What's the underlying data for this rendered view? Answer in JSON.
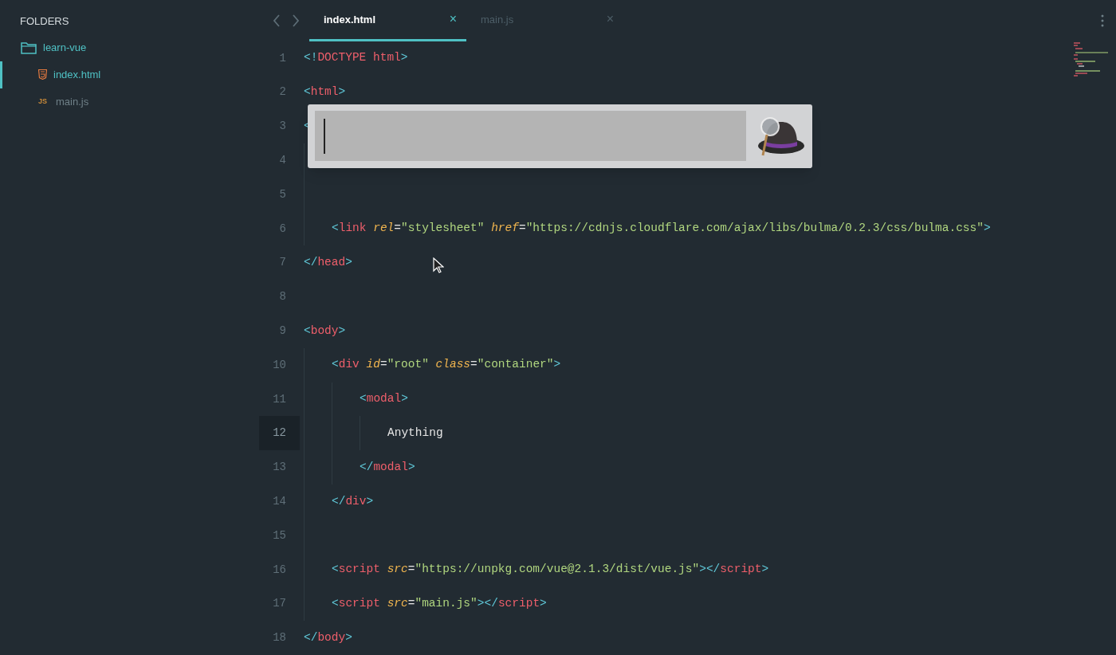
{
  "sidebar": {
    "title": "FOLDERS",
    "tree": [
      {
        "label": "learn-vue",
        "kind": "folder",
        "expanded": true,
        "selected": false,
        "children": [
          {
            "label": "index.html",
            "kind": "html",
            "selected": true
          },
          {
            "label": "main.js",
            "kind": "js",
            "badge": "JS",
            "selected": false
          }
        ]
      }
    ]
  },
  "tabs": [
    {
      "label": "index.html",
      "selected": true,
      "close": "×"
    },
    {
      "label": "main.js",
      "selected": false,
      "close": "×"
    }
  ],
  "editor": {
    "lines": [
      {
        "number": "1",
        "active": false,
        "tokens": [
          {
            "kind": "punct",
            "text": "<!"
          },
          {
            "kind": "tag",
            "text": "DOCTYPE html"
          },
          {
            "kind": "punct",
            "text": ">"
          }
        ]
      },
      {
        "number": "2",
        "active": false,
        "tokens": [
          {
            "kind": "punct",
            "text": "<"
          },
          {
            "kind": "tag",
            "text": "html"
          },
          {
            "kind": "punct",
            "text": ">"
          }
        ]
      },
      {
        "number": "3",
        "active": false,
        "tokens": [
          {
            "kind": "punct",
            "text": "<"
          }
        ],
        "children": [
          {
            "number": "4",
            "active": false
          },
          {
            "number": "5",
            "active": false
          },
          {
            "number": "6",
            "active": false,
            "tokens": [
              {
                "kind": "punct",
                "text": "<"
              },
              {
                "kind": "tag",
                "text": "link "
              },
              {
                "kind": "attr",
                "text": "rel"
              },
              {
                "kind": "plain",
                "text": "="
              },
              {
                "kind": "string",
                "text": "\"stylesheet\" "
              },
              {
                "kind": "attr",
                "text": "href"
              },
              {
                "kind": "plain",
                "text": "="
              },
              {
                "kind": "string",
                "text": "\"https://cdnjs.cloudflare.com/ajax/libs/bulma/0.2.3/css/bulma.css\""
              },
              {
                "kind": "punct",
                "text": ">"
              }
            ]
          }
        ]
      },
      {
        "number": "7",
        "active": false,
        "tokens": [
          {
            "kind": "punct",
            "text": "</"
          },
          {
            "kind": "tag",
            "text": "head"
          },
          {
            "kind": "punct",
            "text": ">"
          }
        ]
      },
      {
        "number": "8",
        "active": false
      },
      {
        "number": "9",
        "active": false,
        "tokens": [
          {
            "kind": "punct",
            "text": "<"
          },
          {
            "kind": "tag",
            "text": "body"
          },
          {
            "kind": "punct",
            "text": ">"
          }
        ],
        "children": [
          {
            "number": "10",
            "active": false,
            "tokens": [
              {
                "kind": "punct",
                "text": "<"
              },
              {
                "kind": "tag",
                "text": "div "
              },
              {
                "kind": "attr",
                "text": "id"
              },
              {
                "kind": "plain",
                "text": "="
              },
              {
                "kind": "string",
                "text": "\"root\" "
              },
              {
                "kind": "attr",
                "text": "class"
              },
              {
                "kind": "plain",
                "text": "="
              },
              {
                "kind": "string",
                "text": "\"container\""
              },
              {
                "kind": "punct",
                "text": ">"
              }
            ],
            "children": [
              {
                "number": "11",
                "active": false,
                "tokens": [
                  {
                    "kind": "punct",
                    "text": "<"
                  },
                  {
                    "kind": "tag",
                    "text": "modal"
                  },
                  {
                    "kind": "punct",
                    "text": ">"
                  }
                ],
                "children": [
                  {
                    "number": "12",
                    "active": true,
                    "tokens": [
                      {
                        "kind": "plain",
                        "text": "Anything"
                      }
                    ]
                  }
                ]
              },
              {
                "number": "13",
                "active": false,
                "tokens": [
                  {
                    "kind": "punct",
                    "text": "</"
                  },
                  {
                    "kind": "tag",
                    "text": "modal"
                  },
                  {
                    "kind": "punct",
                    "text": ">"
                  }
                ]
              }
            ]
          },
          {
            "number": "14",
            "active": false,
            "tokens": [
              {
                "kind": "punct",
                "text": "</"
              },
              {
                "kind": "tag",
                "text": "div"
              },
              {
                "kind": "punct",
                "text": ">"
              }
            ]
          },
          {
            "number": "15",
            "active": false
          },
          {
            "number": "16",
            "active": false,
            "tokens": [
              {
                "kind": "punct",
                "text": "<"
              },
              {
                "kind": "tag",
                "text": "script "
              },
              {
                "kind": "attr",
                "text": "src"
              },
              {
                "kind": "plain",
                "text": "="
              },
              {
                "kind": "string",
                "text": "\"https://unpkg.com/vue@2.1.3/dist/vue.js\""
              },
              {
                "kind": "punct",
                "text": "></"
              },
              {
                "kind": "tag",
                "text": "script"
              },
              {
                "kind": "punct",
                "text": ">"
              }
            ]
          },
          {
            "number": "17",
            "active": false,
            "tokens": [
              {
                "kind": "punct",
                "text": "<"
              },
              {
                "kind": "tag",
                "text": "script "
              },
              {
                "kind": "attr",
                "text": "src"
              },
              {
                "kind": "plain",
                "text": "="
              },
              {
                "kind": "string",
                "text": "\"main.js\""
              },
              {
                "kind": "punct",
                "text": "></"
              },
              {
                "kind": "tag",
                "text": "script"
              },
              {
                "kind": "punct",
                "text": ">"
              }
            ]
          }
        ]
      },
      {
        "number": "18",
        "active": false,
        "tokens": [
          {
            "kind": "punct",
            "text": "</"
          },
          {
            "kind": "tag",
            "text": "body"
          },
          {
            "kind": "punct",
            "text": ">"
          }
        ]
      }
    ]
  }
}
